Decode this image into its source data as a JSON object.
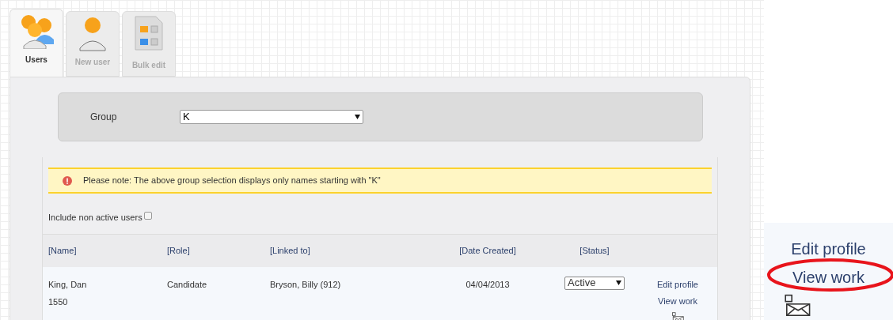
{
  "tabs": [
    {
      "label": "Users",
      "kind": "users",
      "selected": true
    },
    {
      "label": "New user",
      "kind": "new_user",
      "selected": false
    },
    {
      "label": "Bulk edit",
      "kind": "bulk_edit",
      "selected": false
    }
  ],
  "group_filter": {
    "label": "Group",
    "value": "K"
  },
  "notice": "Please note: The above group selection displays only names starting with \"K\"",
  "include_inactive": {
    "label": "Include non active users",
    "checked": false
  },
  "table": {
    "columns": [
      "[Name]",
      "[Role]",
      "[Linked to]",
      "[Date Created]",
      "[Status]"
    ],
    "rows": [
      {
        "name": "King, Dan",
        "id": "1550",
        "role": "Candidate",
        "linked_to": "Bryson, Billy (912)",
        "date_created": "04/04/2013",
        "status": "Active",
        "actions": [
          "Edit profile",
          "View work"
        ]
      }
    ]
  },
  "zoom_inset": {
    "actions": [
      {
        "label": "Edit profile",
        "highlighted": false
      },
      {
        "label": "View work",
        "highlighted": true
      }
    ]
  }
}
